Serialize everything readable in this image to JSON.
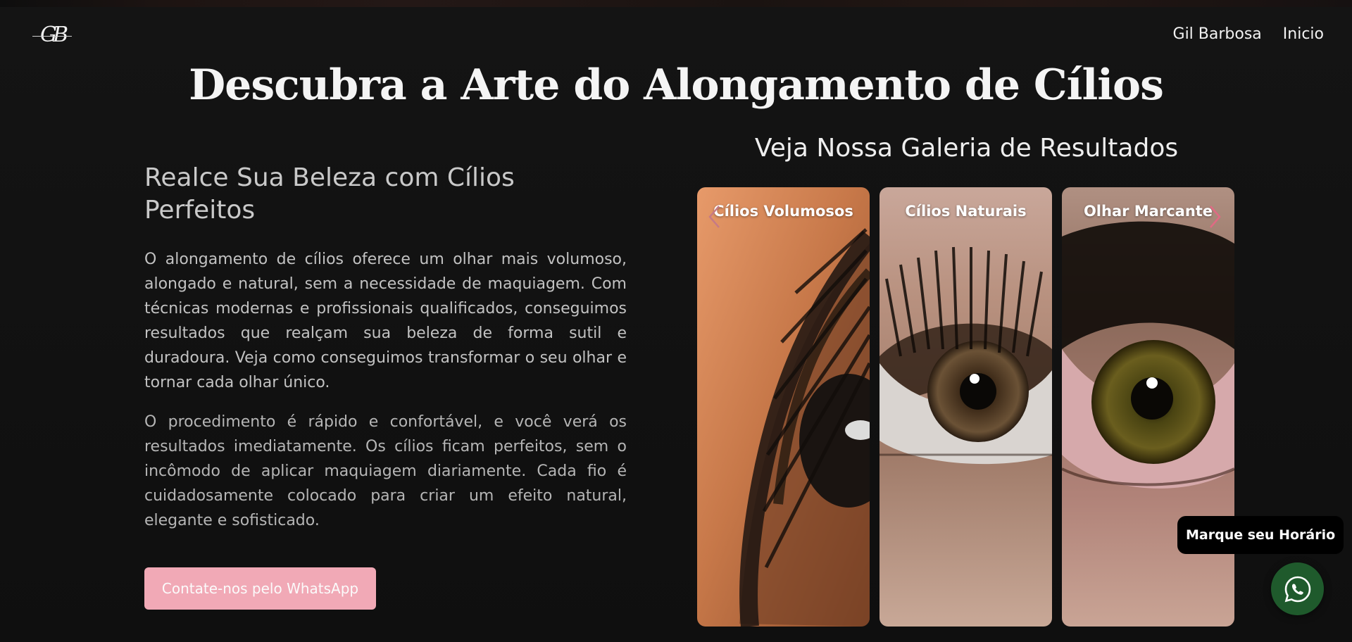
{
  "header": {
    "logo_text": "GB",
    "nav": [
      "Gil Barbosa",
      "Inicio"
    ]
  },
  "hero": {
    "title": "Descubra a Arte do Alongamento de Cílios"
  },
  "left": {
    "subtitle": "Realce Sua Beleza com Cílios Perfeitos",
    "paragraph1": "O alongamento de cílios oferece um olhar mais volumoso, alongado e natural, sem a necessidade de maquiagem. Com técnicas modernas e profissionais qualificados, conseguimos resultados que realçam sua beleza de forma sutil e duradoura. Veja como conseguimos transformar o seu olhar e tornar cada olhar único.",
    "paragraph2": "O procedimento é rápido e confortável, e você verá os resultados imediatamente. Os cílios ficam perfeitos, sem o incômodo de aplicar maquiagem diariamente. Cada fio é cuidadosamente colocado para criar um efeito natural, elegante e sofisticado.",
    "cta_label": "Contate-nos pelo WhatsApp"
  },
  "gallery": {
    "title": "Veja Nossa Galeria de Resultados",
    "cards": [
      {
        "label": "Cílios Volumosos"
      },
      {
        "label": "Cílios Naturais"
      },
      {
        "label": "Olhar Marcante"
      }
    ],
    "prev_icon": "chevron-left-icon",
    "next_icon": "chevron-right-icon"
  },
  "whatsapp": {
    "bubble_text": "Marque seu Horário",
    "icon": "whatsapp-icon"
  },
  "colors": {
    "background": "#121212",
    "cta": "#f1a9b6",
    "whatsapp": "#1f5a2c"
  }
}
